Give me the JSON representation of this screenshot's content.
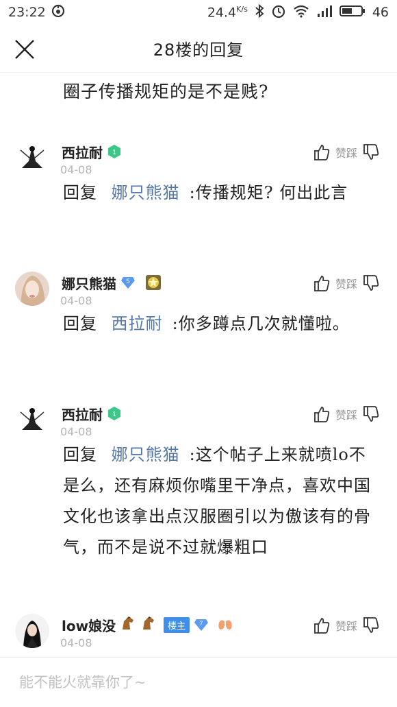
{
  "status_bar": {
    "time": "23:22",
    "speed": "24.4",
    "speed_unit": "K/s",
    "battery": "46"
  },
  "header": {
    "title": "28楼的回复"
  },
  "post": {
    "text": "圈子传播规矩的是不是贱?"
  },
  "replies": [
    {
      "username": "西拉耐",
      "level": "1",
      "date": "04-08",
      "vote_label": "赞踩",
      "reply_prefix": "回复",
      "mention": "娜只熊猫",
      "text": ":传播规矩? 何出此言"
    },
    {
      "username": "娜只熊猫",
      "level": "5",
      "date": "04-08",
      "vote_label": "赞踩",
      "reply_prefix": "回复",
      "mention": "西拉耐",
      "text": ":你多蹲点几次就懂啦。"
    },
    {
      "username": "西拉耐",
      "level": "1",
      "date": "04-08",
      "vote_label": "赞踩",
      "reply_prefix": "回复",
      "mention": "娜只熊猫",
      "text": ":这个帖子上来就喷lo不是么，还有麻烦你嘴里干净点，喜欢中国文化也该拿出点汉服圈引以为傲该有的骨气，而不是说不过就爆粗口"
    },
    {
      "username": "low娘没",
      "lz_label": "楼主",
      "level": "7",
      "date": "04-08",
      "vote_label": "赞踩"
    }
  ],
  "input": {
    "placeholder": "能不能火就靠你了~"
  },
  "colors": {
    "mention": "#5679a8",
    "level_green": "#3dc88a",
    "level_blue": "#5a9af0",
    "lz_badge": "#3f8fe8"
  }
}
